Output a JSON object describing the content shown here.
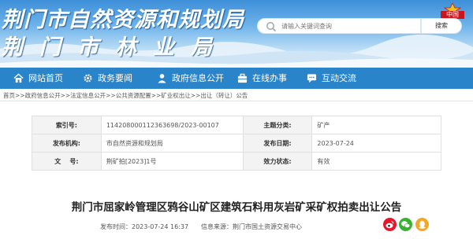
{
  "site": {
    "title_line1": "荆门市自然资源和规划局",
    "title_line2": "荆门市林业局",
    "emblem_text": "中国"
  },
  "search": {
    "placeholder": "请输入关键词查询",
    "button_label": "搜索"
  },
  "nav": {
    "items": [
      {
        "label": "网站首页",
        "icon": "home-icon"
      },
      {
        "label": "政务要闻",
        "icon": "settings-icon"
      },
      {
        "label": "政府信息公开",
        "icon": "user-icon"
      },
      {
        "label": "在线办事",
        "icon": "briefcase-icon"
      },
      {
        "label": "互动交流",
        "icon": "chat-icon"
      }
    ]
  },
  "breadcrumb": "首页>>政府信息公开>>法定信息公开>>公共资源配置>>矿业权出让>>出让（转让）公告",
  "info": {
    "index_label": "索引号:",
    "index_value": "114208000112363698/2023-00107",
    "topic_label": "主题分类:",
    "topic_value": "矿产",
    "org_label": "发布机构:",
    "org_value": "市自然资源和规划局",
    "date_label": "发布日期:",
    "date_value": "2023-07-24",
    "docno_label": "文    号:",
    "docno_value": "荆矿拍[2023]1号",
    "status_label": "效力状态:",
    "status_value": "有效"
  },
  "article": {
    "title": "荆门市屈家岭管理区鸦谷山矿区建筑石料用灰岩矿采矿权拍卖出让公告",
    "published": "发布时间：2023-07-24 16:37",
    "source": "信息来源：荆门市国土资源交易中心"
  },
  "colors": {
    "nav_bg": "#2a84c9",
    "weibo": "#e6162d",
    "wechat": "#3cb034",
    "qq": "#f5a623"
  }
}
